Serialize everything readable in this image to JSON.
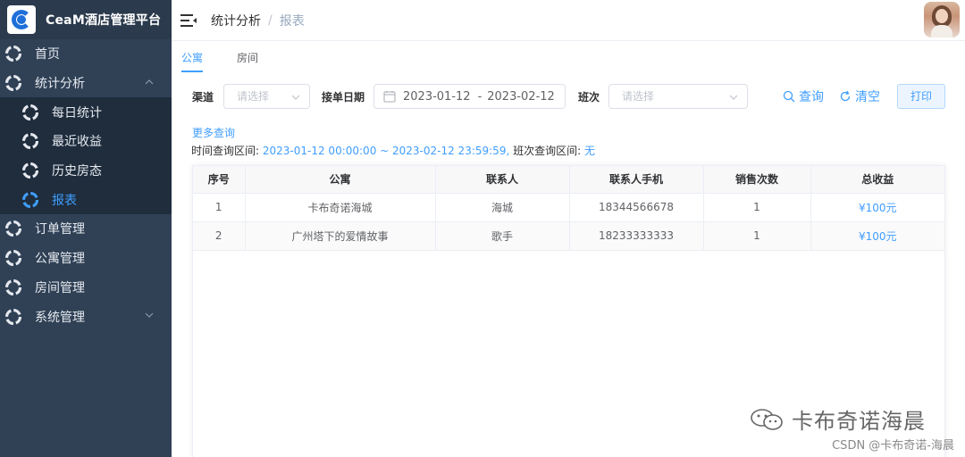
{
  "app": {
    "title": "CeaM酒店管理平台"
  },
  "sidebar": {
    "items": [
      {
        "label": "首页",
        "level": 1
      },
      {
        "label": "统计分析",
        "level": 1,
        "expanded": true
      },
      {
        "label": "每日统计",
        "level": 2
      },
      {
        "label": "最近收益",
        "level": 2
      },
      {
        "label": "历史房态",
        "level": 2
      },
      {
        "label": "报表",
        "level": 2,
        "active": true
      },
      {
        "label": "订单管理",
        "level": 1
      },
      {
        "label": "公寓管理",
        "level": 1
      },
      {
        "label": "房间管理",
        "level": 1
      },
      {
        "label": "系统管理",
        "level": 1,
        "expanded": false
      }
    ]
  },
  "header": {
    "breadcrumb": [
      "统计分析",
      "报表"
    ]
  },
  "tabs": [
    {
      "label": "公寓",
      "active": true
    },
    {
      "label": "房间",
      "active": false
    }
  ],
  "filters": {
    "channel_label": "渠道",
    "channel_placeholder": "请选择",
    "date_label": "接单日期",
    "date_start": "2023-01-12",
    "date_sep": "-",
    "date_end": "2023-02-12",
    "shift_label": "班次",
    "shift_placeholder": "请选择",
    "query_label": "查询",
    "clear_label": "清空",
    "print_label": "打印"
  },
  "query_info": {
    "more_label": "更多查询",
    "time_range_label": "时间查询区间:",
    "time_range_value": "2023-01-12 00:00:00 ~ 2023-02-12 23:59:59,",
    "shift_range_label": "班次查询区间:",
    "shift_range_value": "无"
  },
  "table": {
    "columns": [
      "序号",
      "公寓",
      "联系人",
      "联系人手机",
      "销售次数",
      "总收益"
    ],
    "rows": [
      [
        "1",
        "卡布奇诺海城",
        "海城",
        "18344566678",
        "1",
        "¥100元"
      ],
      [
        "2",
        "广州塔下的爱情故事",
        "歌手",
        "18233333333",
        "1",
        "¥100元"
      ]
    ]
  },
  "watermark": {
    "text": "卡布奇诺海晨",
    "csdn": "CSDN @卡布奇诺-海晨"
  },
  "colors": {
    "sidebar_bg": "#304156",
    "submenu_bg": "#1f2d3d",
    "accent": "#409eff"
  }
}
